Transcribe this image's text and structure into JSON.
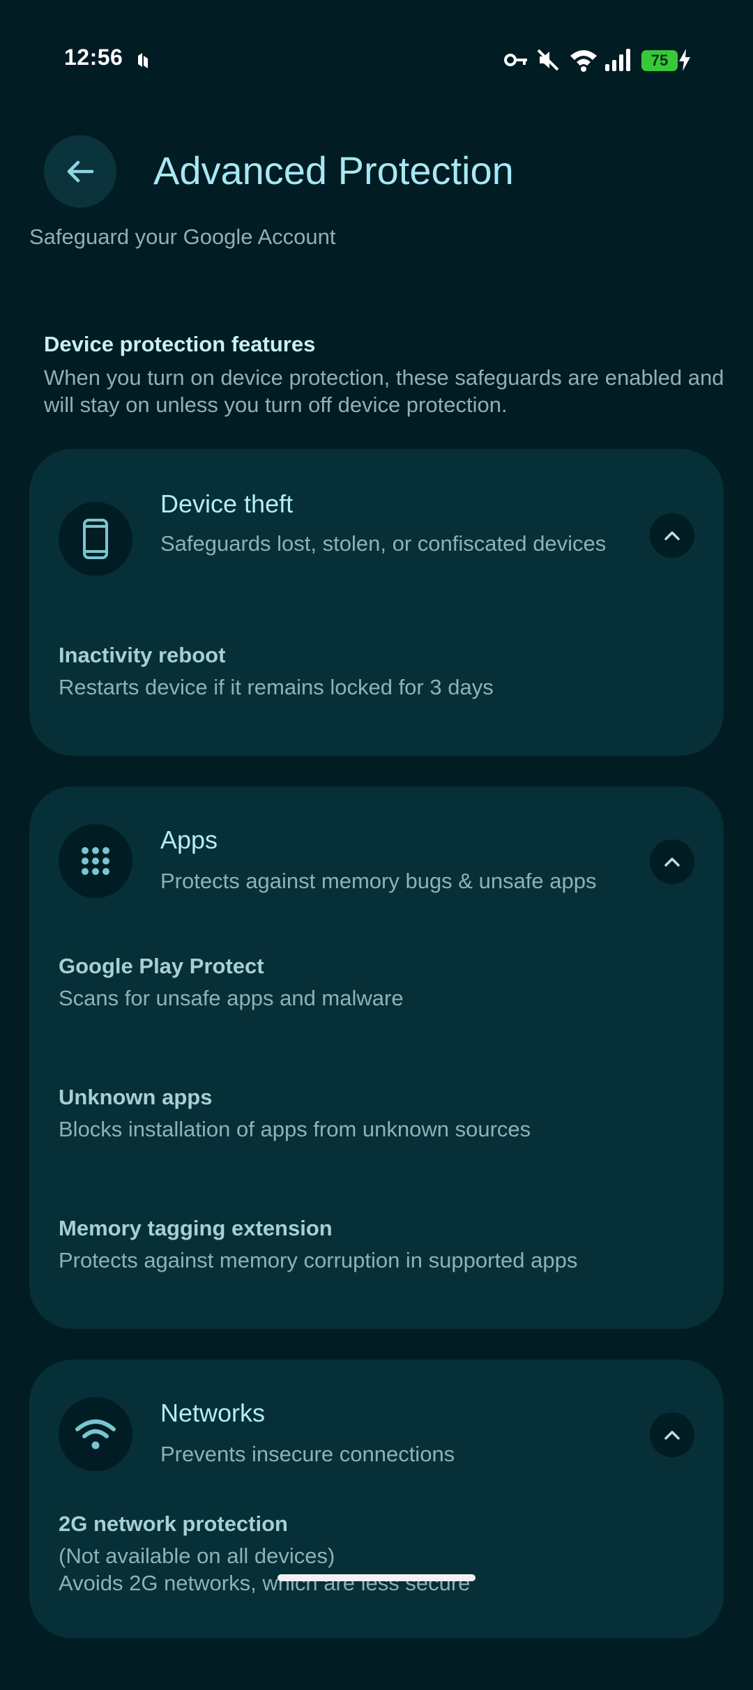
{
  "status_bar": {
    "time": "12:56",
    "battery_level": "75",
    "icons": [
      "vpn-key-icon",
      "mute-icon",
      "wifi-icon",
      "cellular-signal-icon",
      "battery-icon",
      "charging-bolt-icon"
    ]
  },
  "header": {
    "title": "Advanced Protection",
    "subtitle": "Safeguard your Google Account"
  },
  "section": {
    "title": "Device protection features",
    "description": "When you turn on device protection, these safeguards are enabled and will stay on unless you turn off device protection."
  },
  "cards": [
    {
      "title": "Device theft",
      "description": "Safeguards lost, stolen, or confiscated devices",
      "icon": "phone-icon",
      "items": [
        {
          "title": "Inactivity reboot",
          "description": "Restarts device if it remains locked for 3 days"
        }
      ]
    },
    {
      "title": "Apps",
      "description": "Protects against memory bugs & unsafe apps",
      "icon": "apps-grid-icon",
      "items": [
        {
          "title": "Google Play Protect",
          "description": "Scans for unsafe apps and malware"
        },
        {
          "title": "Unknown apps",
          "description": "Blocks installation of apps from unknown sources"
        },
        {
          "title": "Memory tagging extension",
          "description": "Protects against memory corruption in supported apps"
        }
      ]
    },
    {
      "title": "Networks",
      "description": "Prevents insecure connections",
      "icon": "wifi-icon",
      "items": [
        {
          "title": "2G network protection",
          "description": "(Not available on all devices)\nAvoids 2G networks, which are less secure"
        }
      ]
    }
  ],
  "colors": {
    "background": "#021c23",
    "card": "#062f38",
    "accent": "#a6e9f4",
    "battery": "#37c93c"
  }
}
